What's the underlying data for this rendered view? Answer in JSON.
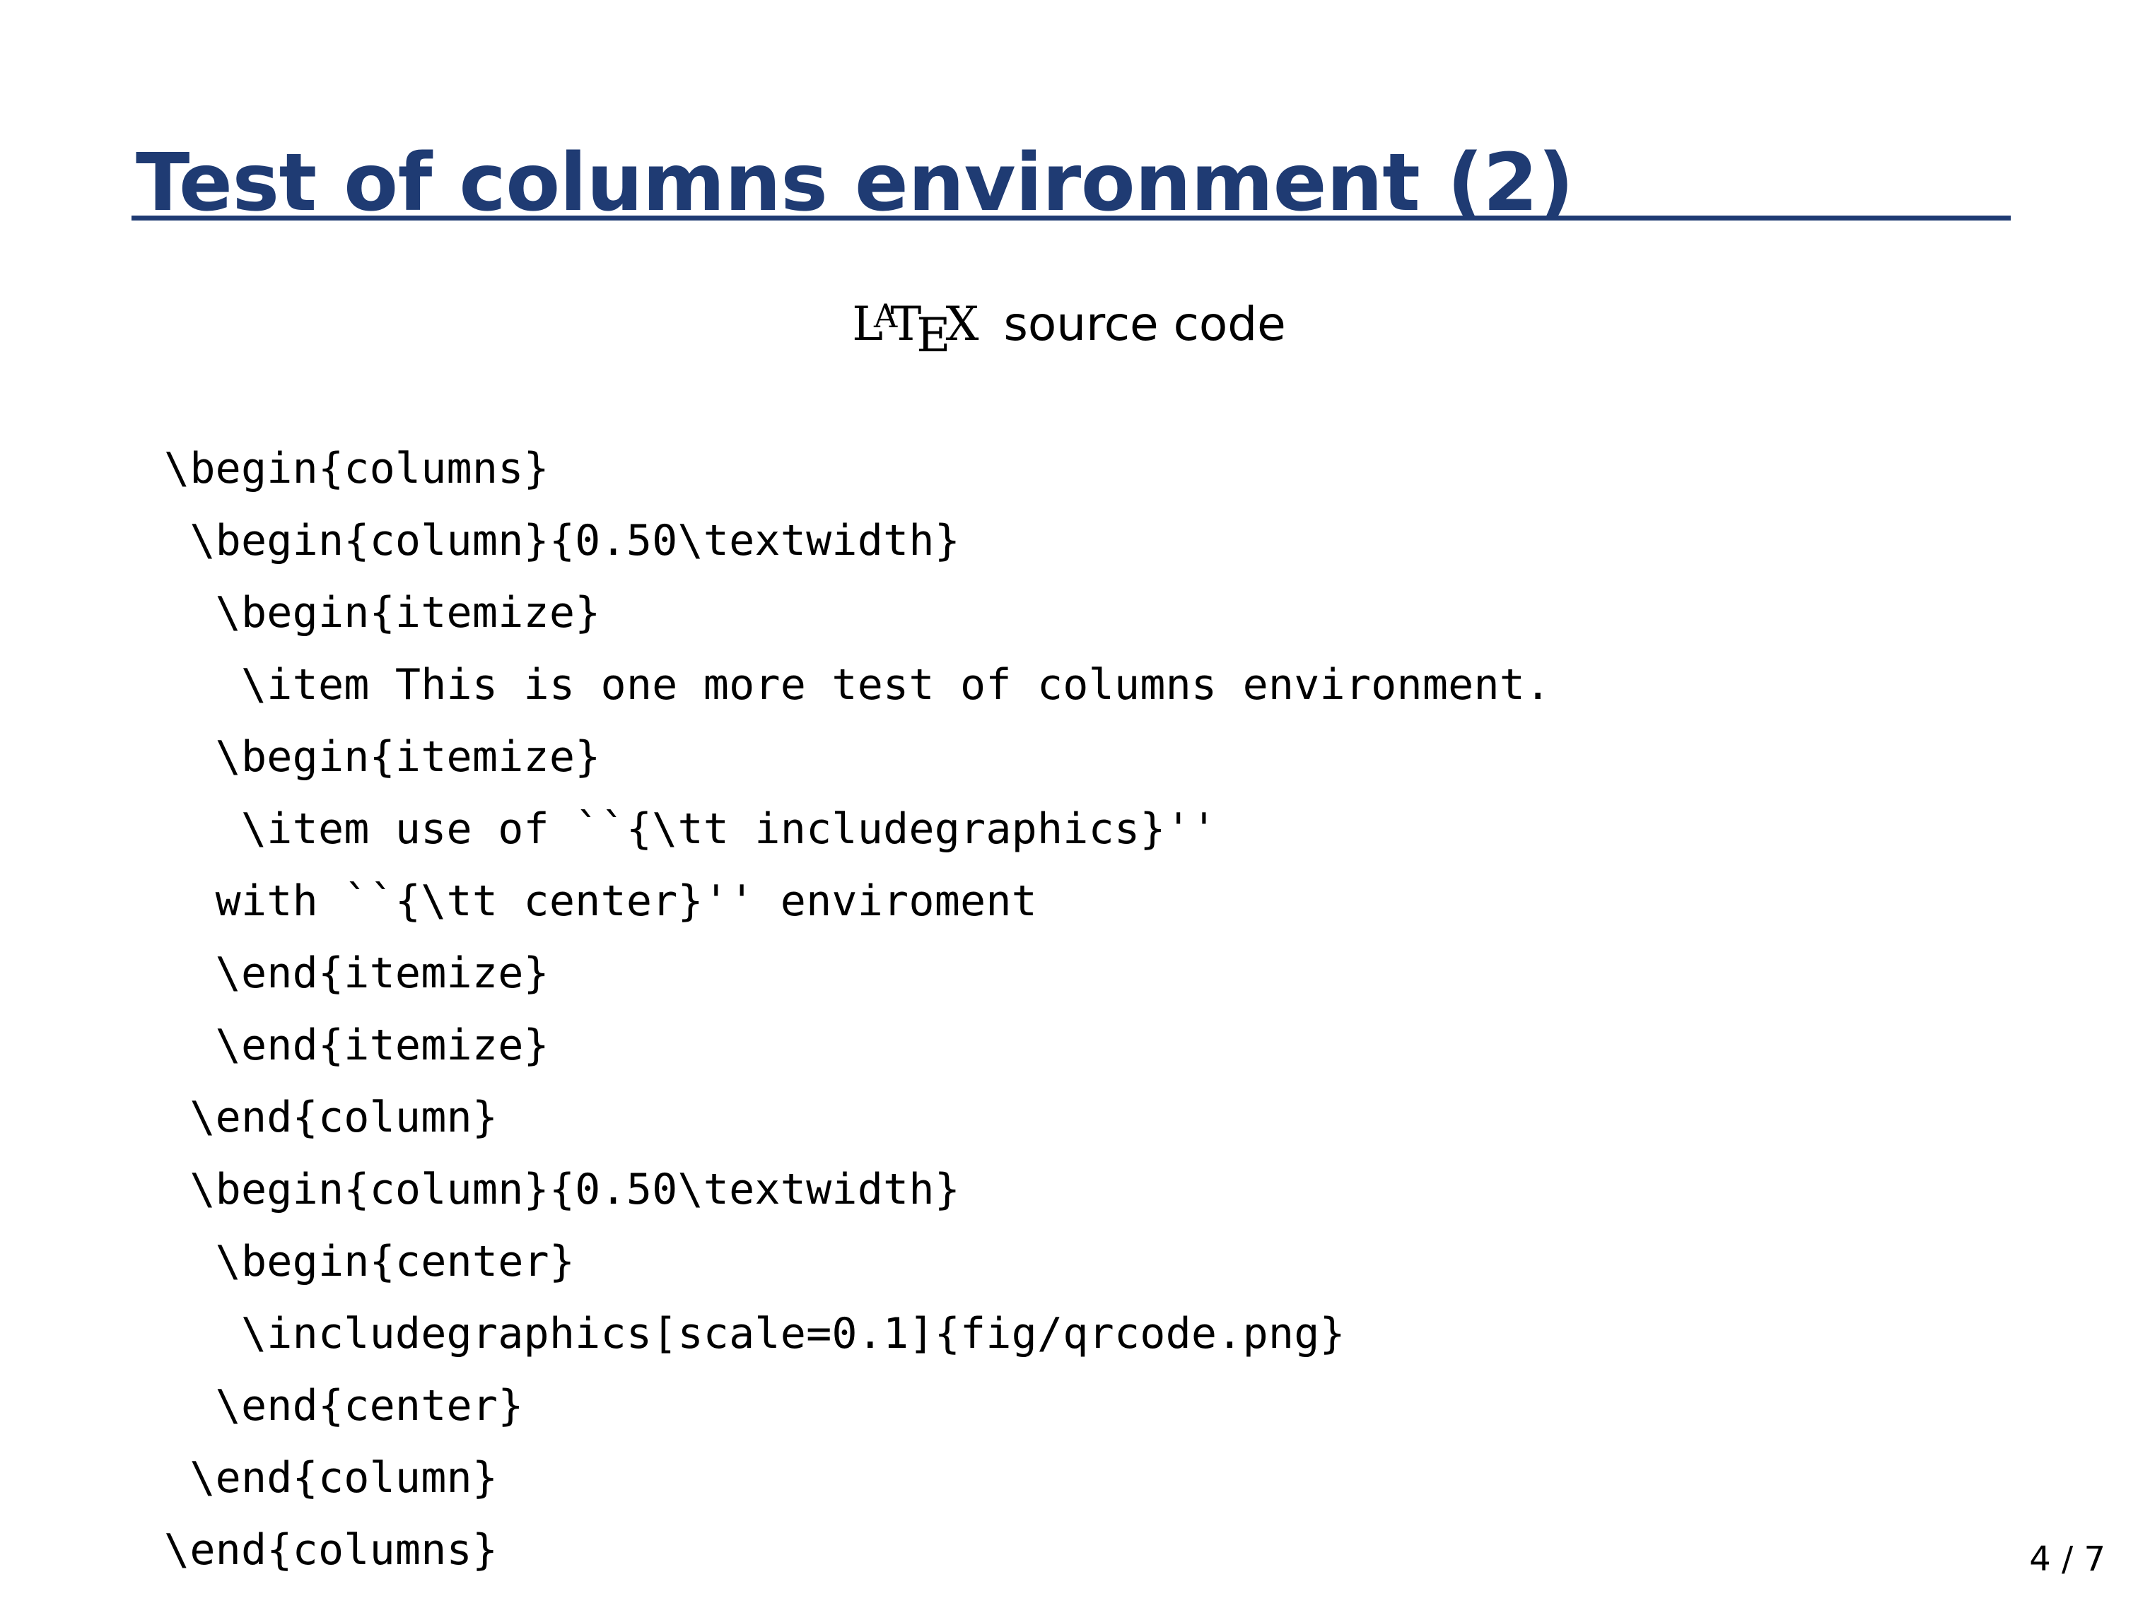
{
  "slide": {
    "title": "Test of columns environment (2)",
    "rule_color": "#1F3B73",
    "title_color": "#1F3B73",
    "background_color": "#ffffff",
    "body_text_color": "#000000"
  },
  "subtitle": {
    "logo_parts": {
      "L": "L",
      "A": "A",
      "T": "T",
      "E": "E",
      "X": "X"
    },
    "words": "source code",
    "full_text": "LaTeX source code"
  },
  "code": {
    "language": "latex",
    "lines": [
      "\\begin{columns}",
      " \\begin{column}{0.50\\textwidth}",
      "  \\begin{itemize}",
      "   \\item This is one more test of columns environment.",
      "  \\begin{itemize}",
      "   \\item use of ``{\\tt includegraphics}''",
      "  with ``{\\tt center}'' enviroment",
      "  \\end{itemize}",
      "  \\end{itemize}",
      " \\end{column}",
      " \\begin{column}{0.50\\textwidth}",
      "  \\begin{center}",
      "   \\includegraphics[scale=0.1]{fig/qrcode.png}",
      "  \\end{center}",
      " \\end{column}",
      "\\end{columns}"
    ]
  },
  "footer": {
    "page_number": "4 / 7",
    "current_page": 4,
    "total_pages": 7
  }
}
